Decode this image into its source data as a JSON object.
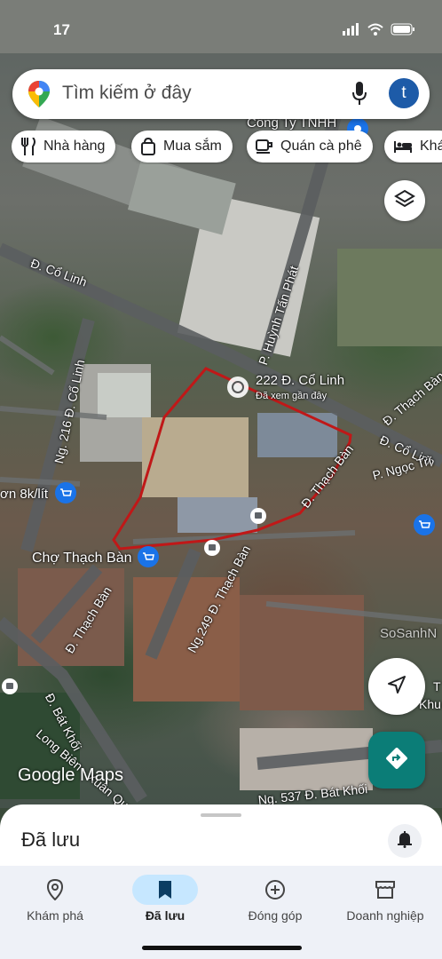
{
  "status_bar": {
    "time": "17"
  },
  "search": {
    "placeholder": "Tìm kiếm ở đây",
    "avatar_letter": "t"
  },
  "chips": [
    {
      "label": "Nhà hàng",
      "icon": "restaurant-icon"
    },
    {
      "label": "Mua sắm",
      "icon": "shopping-bag-icon"
    },
    {
      "label": "Quán cà phê",
      "icon": "coffee-icon"
    },
    {
      "label": "Khá",
      "icon": "hotel-bed-icon"
    }
  ],
  "map_labels": {
    "cong_ty": "Công Ty TNHH",
    "co_linh_road_left": "Đ. Cổ Linh",
    "huynh_tan_phat": "P. Huỳnh Tấn Phát",
    "ng_216": "Ng. 216 Đ. Cổ Linh",
    "place_222": "222 Đ. Cổ Linh",
    "place_222_sub": "Đã xem gần đây",
    "thach_ban_right": "Đ. Thạch Bàn",
    "co_linh_right": "Đ. Cổ Linh",
    "ngoc_tri": "P. Ngọc Trì",
    "thach_ban_mid": "Đ. Thạch Bàn",
    "fuel": "ơn 8k/lít",
    "cho_thach_ban": "Chợ Thạch Bàn",
    "thach_ban_lower": "Đ. Thạch Bàn",
    "ng_249": "Ng.249 Đ. Thạch Bàn",
    "bat_khoi": "Đ. Bát Khối",
    "long_bien": "Long Biên - Xuân Quan",
    "ng_537": "Ng. 537 Đ. Bát Khối",
    "right_t": "T",
    "right_khu": "Khu",
    "watermark": "SoSanhN"
  },
  "google_logo": "Google Maps",
  "sheet": {
    "title": "Đã lưu"
  },
  "nav": [
    {
      "label": "Khám phá",
      "icon": "location-pin-icon",
      "active": false
    },
    {
      "label": "Đã lưu",
      "icon": "bookmark-icon",
      "active": true
    },
    {
      "label": "Đóng góp",
      "icon": "add-circle-icon",
      "active": false
    },
    {
      "label": "Doanh nghiệp",
      "icon": "storefront-icon",
      "active": false
    }
  ],
  "colors": {
    "accent": "#1a73e8",
    "direction_btn": "#0b7d77",
    "outline": "#c01818",
    "nav_active": "#c6e7ff"
  }
}
